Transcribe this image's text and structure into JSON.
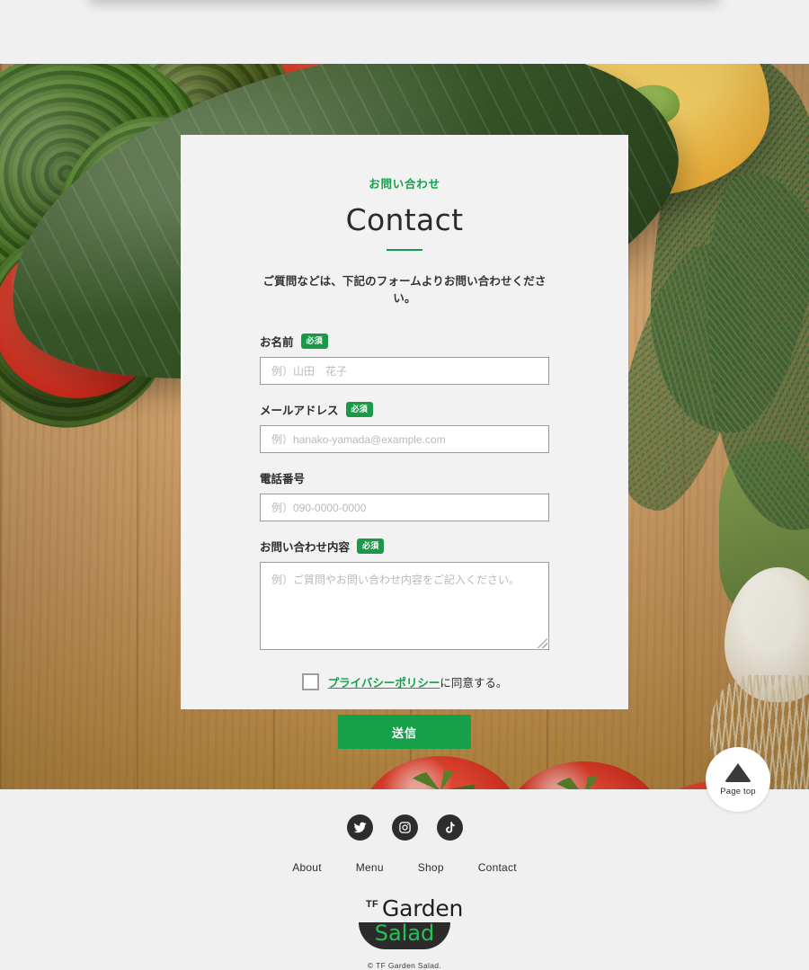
{
  "page": {
    "eyebrow": "お問い合わせ",
    "title": "Contact",
    "lead": "ご質問などは、下記のフォームよりお問い合わせください。"
  },
  "colors": {
    "accent_green": "#12a04a",
    "badge_green": "#1a9a48",
    "submit_green": "#16a04a",
    "card_bg": "#f2f2f2",
    "page_bg": "#f0f0f0"
  },
  "form": {
    "required_badge": "必須",
    "fields": [
      {
        "label": "お名前",
        "required": true,
        "placeholder": "例）山田　花子",
        "type": "text",
        "name": "name"
      },
      {
        "label": "メールアドレス",
        "required": true,
        "placeholder": "例）hanako-yamada@example.com",
        "type": "email",
        "name": "email"
      },
      {
        "label": "電話番号",
        "required": false,
        "placeholder": "例）090-0000-0000",
        "type": "tel",
        "name": "phone"
      },
      {
        "label": "お問い合わせ内容",
        "required": true,
        "placeholder": "例）ご質問やお問い合わせ内容をご記入ください。",
        "type": "textarea",
        "name": "message"
      }
    ],
    "agree": {
      "link_text": "プライバシーポリシー",
      "suffix_text": "に同意する。",
      "checked": false
    },
    "submit_label": "送信"
  },
  "page_top": {
    "label": "Page top",
    "icon": "triangle-up-icon"
  },
  "footer": {
    "socials": [
      {
        "name": "twitter",
        "icon": "twitter-icon"
      },
      {
        "name": "instagram",
        "icon": "instagram-icon"
      },
      {
        "name": "tiktok",
        "icon": "tiktok-icon"
      }
    ],
    "nav": [
      {
        "label": "About"
      },
      {
        "label": "Menu"
      },
      {
        "label": "Shop"
      },
      {
        "label": "Contact"
      }
    ],
    "logo": {
      "tf": "TF",
      "garden": "Garden",
      "salad": "Salad"
    },
    "copyright": "© TF Garden Salad."
  }
}
